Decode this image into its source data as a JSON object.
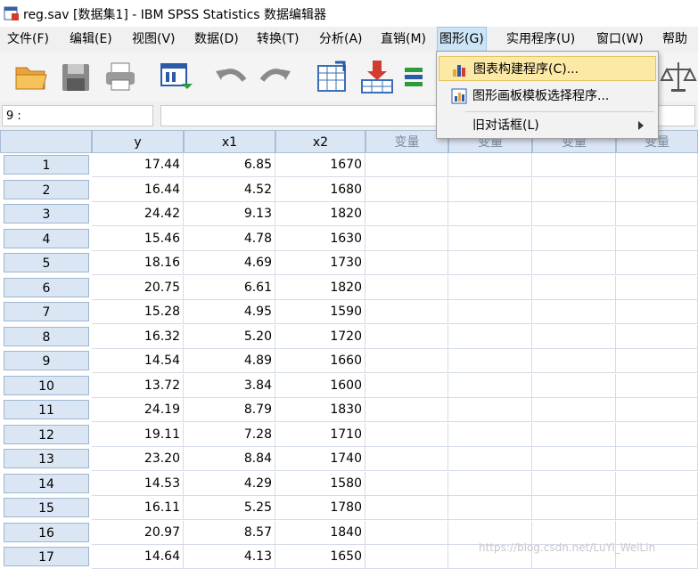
{
  "window": {
    "title": "reg.sav [数据集1] - IBM SPSS Statistics 数据编辑器"
  },
  "menu": [
    "文件(F)",
    "编辑(E)",
    "视图(V)",
    "数据(D)",
    "转换(T)",
    "分析(A)",
    "直销(M)",
    "图形(G)",
    "实用程序(U)",
    "窗口(W)",
    "帮助"
  ],
  "graph_menu": {
    "items": [
      {
        "label": "图表构建程序(C)...",
        "icon": "chart-builder-icon"
      },
      {
        "label": "图形画板模板选择程序...",
        "icon": "graphboard-icon"
      },
      {
        "label": "旧对话框(L)",
        "icon": "submenu-arrow"
      }
    ]
  },
  "cellbar": {
    "ref": "9 :",
    "value": ""
  },
  "grid": {
    "columns": [
      "y",
      "x1",
      "x2",
      "变量",
      "变量",
      "变量",
      "变量"
    ],
    "rows": [
      {
        "n": "1",
        "y": "17.44",
        "x1": "6.85",
        "x2": "1670"
      },
      {
        "n": "2",
        "y": "16.44",
        "x1": "4.52",
        "x2": "1680"
      },
      {
        "n": "3",
        "y": "24.42",
        "x1": "9.13",
        "x2": "1820"
      },
      {
        "n": "4",
        "y": "15.46",
        "x1": "4.78",
        "x2": "1630"
      },
      {
        "n": "5",
        "y": "18.16",
        "x1": "4.69",
        "x2": "1730"
      },
      {
        "n": "6",
        "y": "20.75",
        "x1": "6.61",
        "x2": "1820"
      },
      {
        "n": "7",
        "y": "15.28",
        "x1": "4.95",
        "x2": "1590"
      },
      {
        "n": "8",
        "y": "16.32",
        "x1": "5.20",
        "x2": "1720"
      },
      {
        "n": "9",
        "y": "14.54",
        "x1": "4.89",
        "x2": "1660"
      },
      {
        "n": "10",
        "y": "13.72",
        "x1": "3.84",
        "x2": "1600"
      },
      {
        "n": "11",
        "y": "24.19",
        "x1": "8.79",
        "x2": "1830"
      },
      {
        "n": "12",
        "y": "19.11",
        "x1": "7.28",
        "x2": "1710"
      },
      {
        "n": "13",
        "y": "23.20",
        "x1": "8.84",
        "x2": "1740"
      },
      {
        "n": "14",
        "y": "14.53",
        "x1": "4.29",
        "x2": "1580"
      },
      {
        "n": "15",
        "y": "16.11",
        "x1": "5.25",
        "x2": "1780"
      },
      {
        "n": "16",
        "y": "20.97",
        "x1": "8.57",
        "x2": "1840"
      },
      {
        "n": "17",
        "y": "14.64",
        "x1": "4.13",
        "x2": "1650"
      }
    ]
  },
  "watermark": "https://blog.csdn.net/LuYi_WeiLin",
  "colors": {
    "header_bg": "#dbe6f4",
    "menu_highlight": "#fde9a6",
    "open_menu": "#cce4f7"
  }
}
